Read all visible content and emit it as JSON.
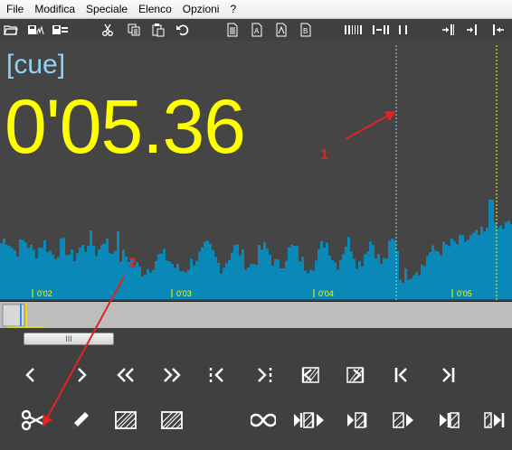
{
  "menu": [
    "File",
    "Modifica",
    "Speciale",
    "Elenco",
    "Opzioni",
    "?"
  ],
  "display": {
    "cue_label": "[cue]",
    "time": "0'05.36"
  },
  "timeline": {
    "labels": [
      "0'02",
      "0'03",
      "0'04",
      "0'05"
    ]
  },
  "scroll_grip": "III",
  "annotations": [
    "1",
    "2"
  ],
  "colors": {
    "waveform": "#0a88b8",
    "time": "#ffff00",
    "cue": "#8fd3f4",
    "arrow": "#e32222"
  },
  "toolbar_icons": [
    "open-folder-icon",
    "save-wave-icon",
    "save-list-icon",
    "cut-icon",
    "copy-icon",
    "paste-icon",
    "undo-icon",
    "page-icon",
    "page-ab-icon",
    "page-a-icon",
    "page-b-icon",
    "bars-icon",
    "dash-bars-icon",
    "pause-bars-icon",
    "mark-in-icon",
    "mark-center-icon",
    "mark-out-icon"
  ],
  "transport_buttons": [
    "prev-icon",
    "next-icon",
    "rewind-icon",
    "fast-forward-icon",
    "jump-back-icon",
    "jump-forward-icon",
    "region-back-icon",
    "region-forward-icon",
    "go-start-icon",
    "go-end-icon"
  ],
  "edit_buttons": [
    "scissors-icon",
    "pencil-icon",
    "hatch-region-icon",
    "hatch-region-icon-2",
    "loop-icon",
    "play-region-icon",
    "play-to-end-icon",
    "play-hatch-icon",
    "play-from-mark-icon",
    "play-end-icon"
  ]
}
